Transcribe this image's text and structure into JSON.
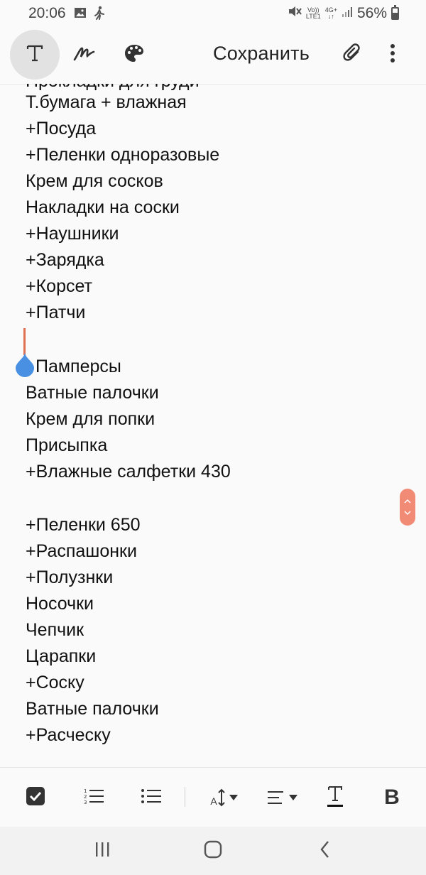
{
  "status_bar": {
    "time": "20:06",
    "network_top": "Vo))",
    "network_bottom": "LTE1",
    "data_top": "4G+",
    "data_bottom": "↓↑",
    "battery": "56%"
  },
  "toolbar": {
    "save_label": "Сохранить",
    "icons": [
      "text-mode-icon",
      "handwriting-icon",
      "palette-icon",
      "attachment-icon",
      "more-options-icon"
    ]
  },
  "note": {
    "clipped_first_line": "Прокладки для груди",
    "lines": [
      "Т.бумага + влажная",
      "+Посуда",
      "+Пеленки одноразовые",
      "Крем для сосков",
      "Накладки на соски",
      "+Наушники",
      "+Зарядка",
      "+Корсет",
      "+Патчи",
      "",
      "Памперсы",
      "Ватные палочки",
      "Крем для попки",
      "Присыпка",
      "+Влажные салфетки 430",
      "",
      "+Пеленки 650",
      "+Распашонки",
      "+Полузнки",
      "Носочки",
      "Чепчик",
      "Царапки",
      "+Соску",
      "Ватные палочки",
      "+Расческу"
    ]
  },
  "format_bar": {
    "icons": [
      "checkbox-icon",
      "numbered-list-icon",
      "bullet-list-icon",
      "font-size-icon",
      "align-icon",
      "text-color-icon",
      "bold-icon"
    ],
    "bold_label": "B",
    "font_size_label": "A"
  },
  "nav_bar": {
    "icons": [
      "recent-apps-icon",
      "home-icon",
      "back-icon"
    ]
  },
  "colors": {
    "accent": "#f28b76",
    "cursor": "#e07050",
    "handle": "#4a90e2"
  }
}
